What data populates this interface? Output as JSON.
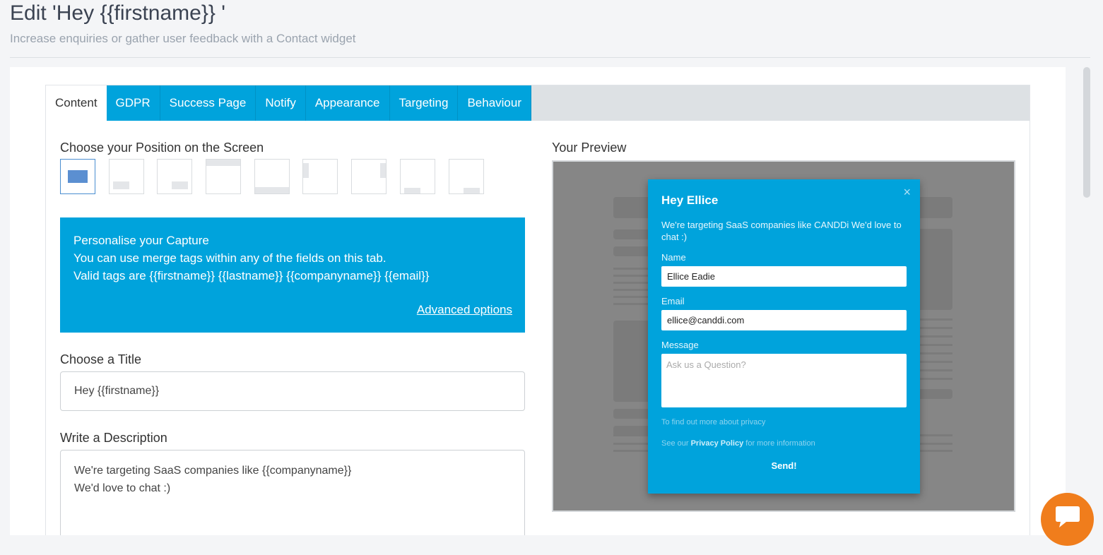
{
  "header": {
    "title": "Edit 'Hey {{firstname}} '",
    "subtitle": "Increase enquiries or gather user feedback with a Contact widget"
  },
  "tabs": [
    {
      "label": "Content",
      "active": true
    },
    {
      "label": "GDPR",
      "active": false
    },
    {
      "label": "Success Page",
      "active": false
    },
    {
      "label": "Notify",
      "active": false
    },
    {
      "label": "Appearance",
      "active": false
    },
    {
      "label": "Targeting",
      "active": false
    },
    {
      "label": "Behaviour",
      "active": false
    }
  ],
  "content": {
    "position_label": "Choose your Position on the Screen",
    "info": {
      "line1": "Personalise your Capture",
      "line2": "You can use merge tags within any of the fields on this tab.",
      "line3": "Valid tags are {{firstname}} {{lastname}} {{companyname}} {{email}}",
      "advanced_link": "Advanced options"
    },
    "title_label": "Choose a Title",
    "title_value": "Hey {{firstname}}",
    "description_label": "Write a Description",
    "description_value": "We're targeting SaaS companies like  {{companyname}}\nWe'd love to chat :)"
  },
  "preview": {
    "label": "Your Preview",
    "widget": {
      "close": "×",
      "title": "Hey Ellice",
      "description": "We're targeting SaaS companies like CANDDi We'd love to chat :)",
      "name_label": "Name",
      "name_value": "Ellice Eadie",
      "email_label": "Email",
      "email_value": "ellice@canddi.com",
      "message_label": "Message",
      "message_placeholder": "Ask us a Question?",
      "privacy_line1": "To find out more about privacy",
      "privacy_prefix": "See our",
      "privacy_link": "Privacy Policy",
      "privacy_suffix": "for more information",
      "send_label": "Send!"
    }
  },
  "colors": {
    "accent": "#00a3dc",
    "chat_button": "#f07d1c"
  }
}
